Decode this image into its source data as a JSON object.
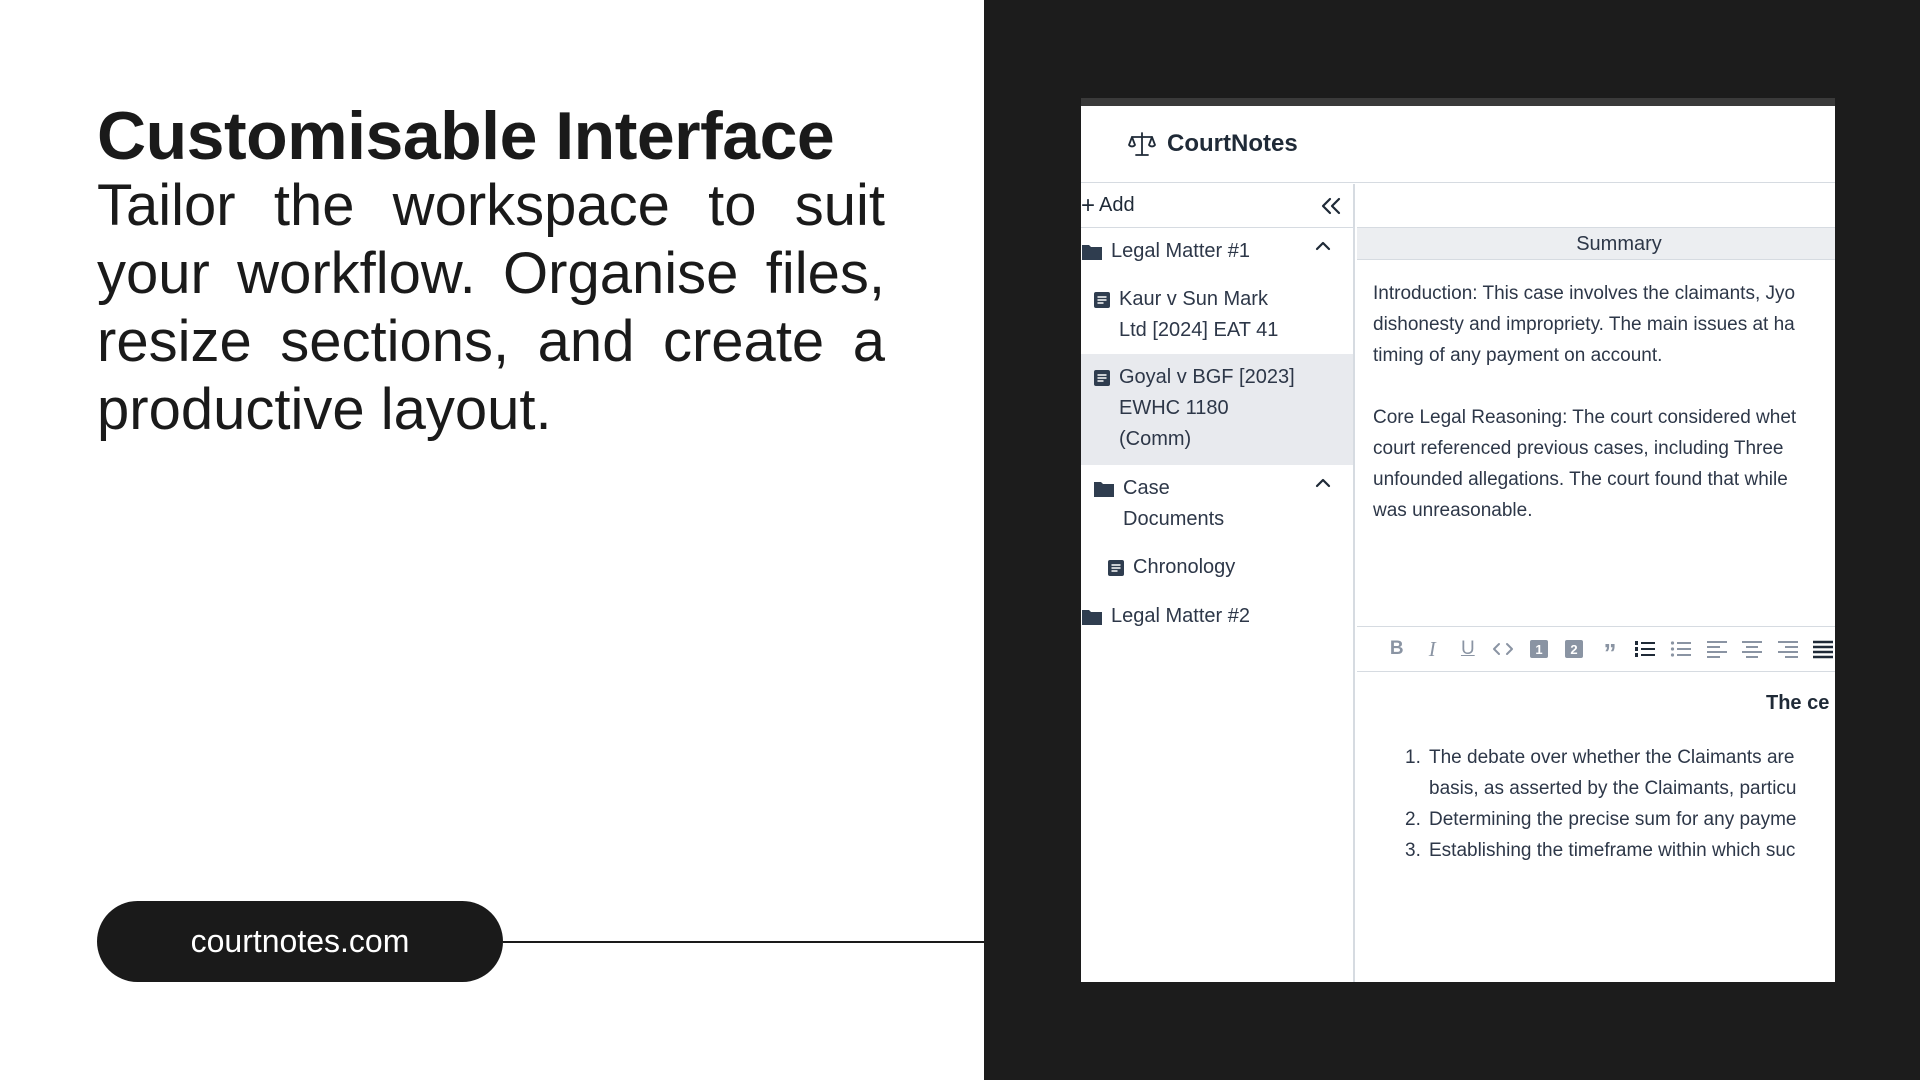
{
  "marketing": {
    "heading": "Customisable Interface",
    "tagline": "Tailor the workspace to suit your workflow. Organise files, resize sections, and create a productive layout.",
    "url": "courtnotes.com"
  },
  "app": {
    "brand": "CourtNotes",
    "sidebar": {
      "add_label": "Add",
      "items": [
        {
          "label": "Legal Matter #1",
          "type": "folder",
          "expanded": true
        },
        {
          "label": "Kaur v Sun Mark Ltd [2024] EAT 41",
          "line1": "Kaur v Sun Mark",
          "line2": "Ltd [2024] EAT 41",
          "type": "document"
        },
        {
          "label": "Goyal v BGF [2023] EWHC 1180 (Comm)",
          "line1": "Goyal v BGF [2023]",
          "line2": "EWHC 1180",
          "line3": "(Comm)",
          "type": "document",
          "selected": true
        },
        {
          "label": "Case Documents",
          "line1": "Case",
          "line2": "Documents",
          "type": "folder",
          "expanded": true
        },
        {
          "label": "Chronology",
          "type": "document"
        },
        {
          "label": "Legal Matter #2",
          "type": "folder"
        }
      ]
    },
    "summary": {
      "header": "Summary",
      "para1": [
        "Introduction: This case involves the claimants, Jyo",
        "dishonesty and impropriety. The main issues at ha",
        "timing of any payment on account."
      ],
      "para2": [
        "Core Legal Reasoning: The court considered whet",
        "court referenced previous cases, including Three",
        "unfounded allegations. The court found that while",
        "was unreasonable."
      ]
    },
    "editor": {
      "title": "The ce",
      "list": [
        {
          "num": "1.",
          "lines": [
            "The debate over whether the Claimants are",
            "basis, as asserted by the Claimants, particu"
          ]
        },
        {
          "num": "2.",
          "lines": [
            "Determining the precise sum for any payme"
          ]
        },
        {
          "num": "3.",
          "lines": [
            "Establishing the timeframe within which suc"
          ]
        }
      ],
      "toolbar": [
        "bold-icon",
        "italic-icon",
        "underline-icon",
        "code-icon",
        "heading-1-icon",
        "heading-2-icon",
        "quote-icon",
        "ordered-list-icon",
        "bullet-list-icon",
        "align-left-icon",
        "align-center-icon",
        "align-right-icon",
        "align-justify-icon"
      ]
    }
  }
}
